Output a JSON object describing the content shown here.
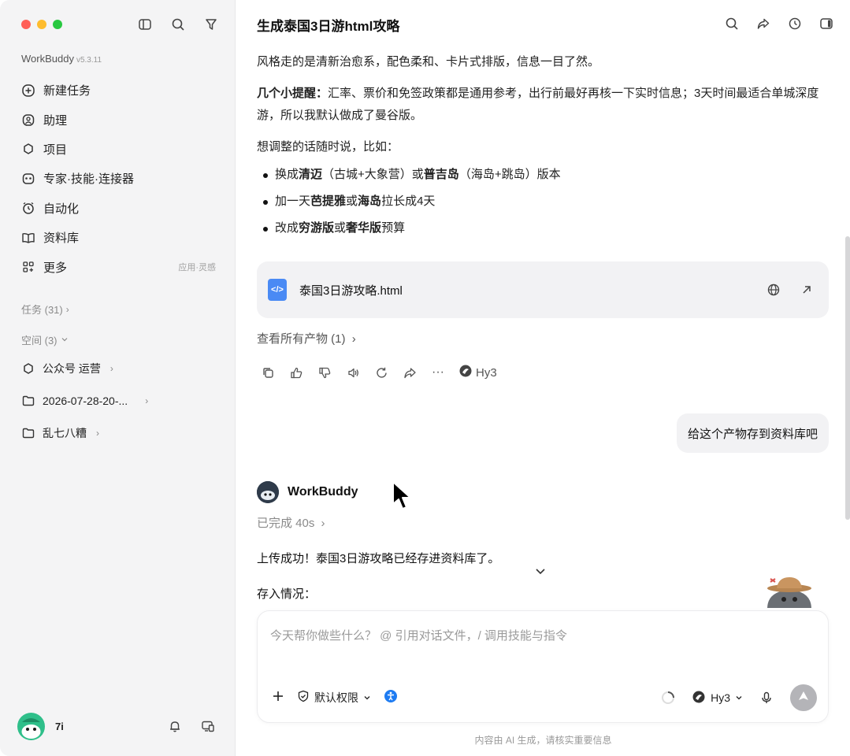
{
  "app": {
    "name": "WorkBuddy",
    "version": "v5.3.11"
  },
  "sidebar": {
    "nav": [
      {
        "label": "新建任务",
        "icon": "plus-circle-icon"
      },
      {
        "label": "助理",
        "icon": "assistant-icon"
      },
      {
        "label": "项目",
        "icon": "project-icon"
      },
      {
        "label": "专家·技能·连接器",
        "icon": "expert-icon"
      },
      {
        "label": "自动化",
        "icon": "alarm-clock-icon"
      },
      {
        "label": "资料库",
        "icon": "book-icon"
      },
      {
        "label": "更多",
        "icon": "grid-icon",
        "note": "应用·灵感"
      }
    ],
    "tasks_header": "任务 (31)",
    "spaces_header": "空间 (3)",
    "spaces": [
      {
        "label": "公众号 运营",
        "icon": "project-icon"
      },
      {
        "label": "2026-07-28-20-...",
        "icon": "folder-icon"
      },
      {
        "label": "乱七八糟",
        "icon": "folder-icon"
      }
    ],
    "user": {
      "name": "7i"
    }
  },
  "main": {
    "title": "生成泰国3日游html攻略",
    "messages": {
      "p1": "风格走的是清新治愈系，配色柔和、卡片式排版，信息一目了然。",
      "p2_prefix": "几个小提醒：",
      "p2_rest": "汇率、票价和免签政策都是通用参考，出行前最好再核一下实时信息；3天时间最适合单城深度游，所以我默认做成了曼谷版。",
      "p3": "想调整的话随时说，比如：",
      "bullets": [
        {
          "a": "换成",
          "b": "清迈",
          "c": "（古城+大象营）或",
          "d": "普吉岛",
          "e": "（海岛+跳岛）版本"
        },
        {
          "a": "加一天",
          "b": "芭提雅",
          "c": "或",
          "d": "海岛",
          "e": "拉长成4天"
        },
        {
          "a": "改成",
          "b": "穷游版",
          "c": "或",
          "d": "奢华版",
          "e": "预算"
        }
      ],
      "file_name": "泰国3日游攻略.html",
      "all_products": "查看所有产物 (1)",
      "model": "Hy3",
      "user_msg": "给这个产物存到资料库吧",
      "bot_name": "WorkBuddy",
      "done_label": "已完成 40s",
      "upload_ok": "上传成功！泰国3日游攻略已经存进资料库了。",
      "deposit": "存入情况："
    },
    "composer": {
      "placeholder": "今天帮你做些什么？ @ 引用对话文件，/ 调用技能与指令",
      "permission": "默认权限",
      "model": "Hy3"
    },
    "footnote": "内容由 AI 生成，请核实重要信息"
  },
  "colors": {
    "sidebar_bg": "#f4f4f5",
    "file_icon": "#4a8af4",
    "accent_blue": "#1d7bf2",
    "send_disabled": "#b4b4b8"
  }
}
